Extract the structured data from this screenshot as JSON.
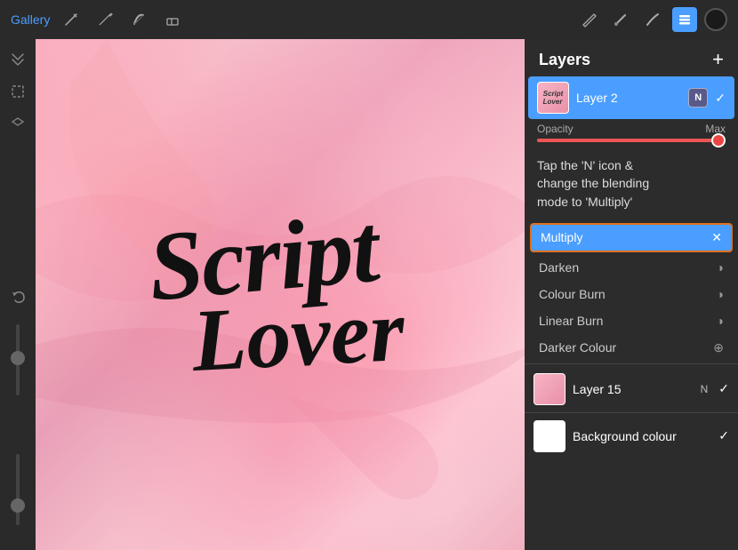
{
  "toolbar": {
    "gallery_label": "Gallery",
    "add_icon": "+",
    "layers_title": "Layers"
  },
  "layers_panel": {
    "title": "Layers",
    "add_btn": "+",
    "layer2": {
      "name": "Layer 2",
      "blend_mode": "N",
      "checked": true
    },
    "opacity": {
      "label": "Opacity",
      "max_label": "Max",
      "value": 100
    },
    "instruction": "Tap the 'N' icon &\nchange the blending\nmode to 'Multiply'",
    "blend_modes": [
      {
        "name": "Multiply",
        "active": true,
        "icon": "✕"
      },
      {
        "name": "Darken",
        "active": false,
        "icon": "◑"
      },
      {
        "name": "Colour Burn",
        "active": false,
        "icon": "◑"
      },
      {
        "name": "Linear Burn",
        "active": false,
        "icon": "◑"
      },
      {
        "name": "Darker Colour",
        "active": false,
        "icon": "⊕"
      }
    ],
    "layer15": {
      "name": "Layer 15",
      "blend_mode": "N",
      "checked": true
    },
    "background": {
      "name": "Background colour",
      "checked": true
    }
  },
  "canvas": {
    "script_line1": "Script",
    "script_line2": "Lover"
  }
}
